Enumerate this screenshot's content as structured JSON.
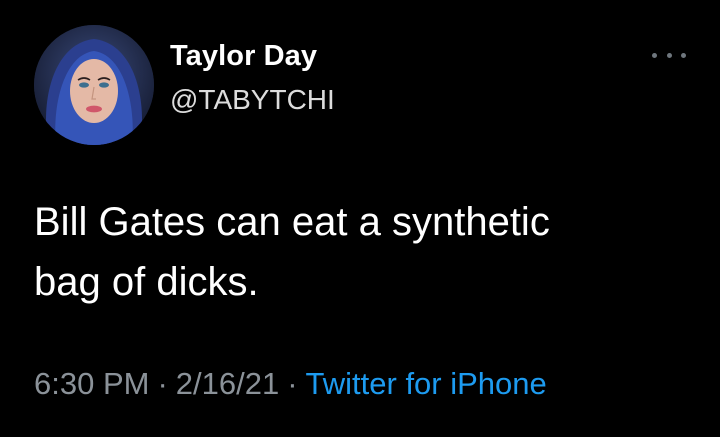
{
  "tweet": {
    "author": {
      "display_name": "Taylor Day",
      "handle": "@TABYTCHI",
      "avatar": "profile-photo"
    },
    "more_icon": "ellipsis-icon",
    "text_lines": [
      "Bill Gates can eat a synthetic",
      "bag of dicks."
    ],
    "time": "6:30 PM",
    "separator": "·",
    "date": "2/16/21",
    "source": "Twitter for iPhone"
  },
  "colors": {
    "background": "#000000",
    "primary_text": "#ffffff",
    "secondary_text": "#8b9299",
    "link": "#1d9bf0"
  }
}
